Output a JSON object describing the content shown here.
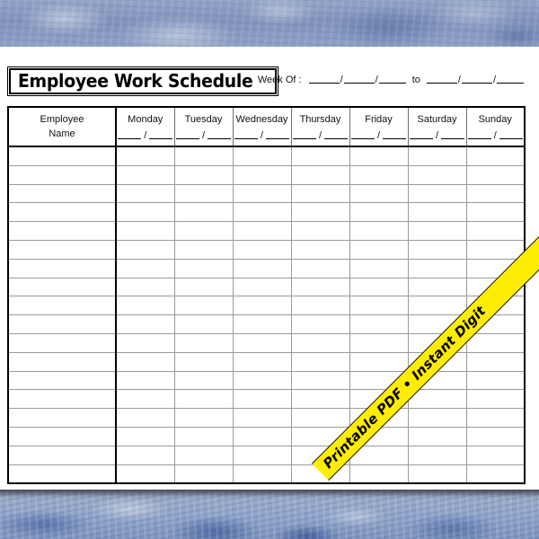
{
  "document": {
    "title": "Employee Work Schedule",
    "week_of": {
      "label": "Week Of :",
      "separator": "/",
      "to_label": "to"
    }
  },
  "table": {
    "employee_column_header_line1": "Employee",
    "employee_column_header_line2": "Name",
    "date_blank_separator": "/",
    "day_columns": [
      {
        "name": "Monday"
      },
      {
        "name": "Tuesday"
      },
      {
        "name": "Wednesday"
      },
      {
        "name": "Thursday"
      },
      {
        "name": "Friday"
      },
      {
        "name": "Saturday"
      },
      {
        "name": "Sunday"
      }
    ],
    "body_row_count": 18,
    "body_rows_are_blank": true
  },
  "promo_ribbon": {
    "text": "Printable PDF • Instant Digit",
    "background_color": "#ffed00",
    "text_color": "#000000",
    "clipped_at_right_edge": true
  },
  "colors": {
    "page_background": "#ffffff",
    "texture_band_blue": "#8193bc",
    "texture_band_bottom_gray": "#7c8ca6",
    "rule_gray": "#9a9a9a",
    "border_black": "#000000"
  }
}
